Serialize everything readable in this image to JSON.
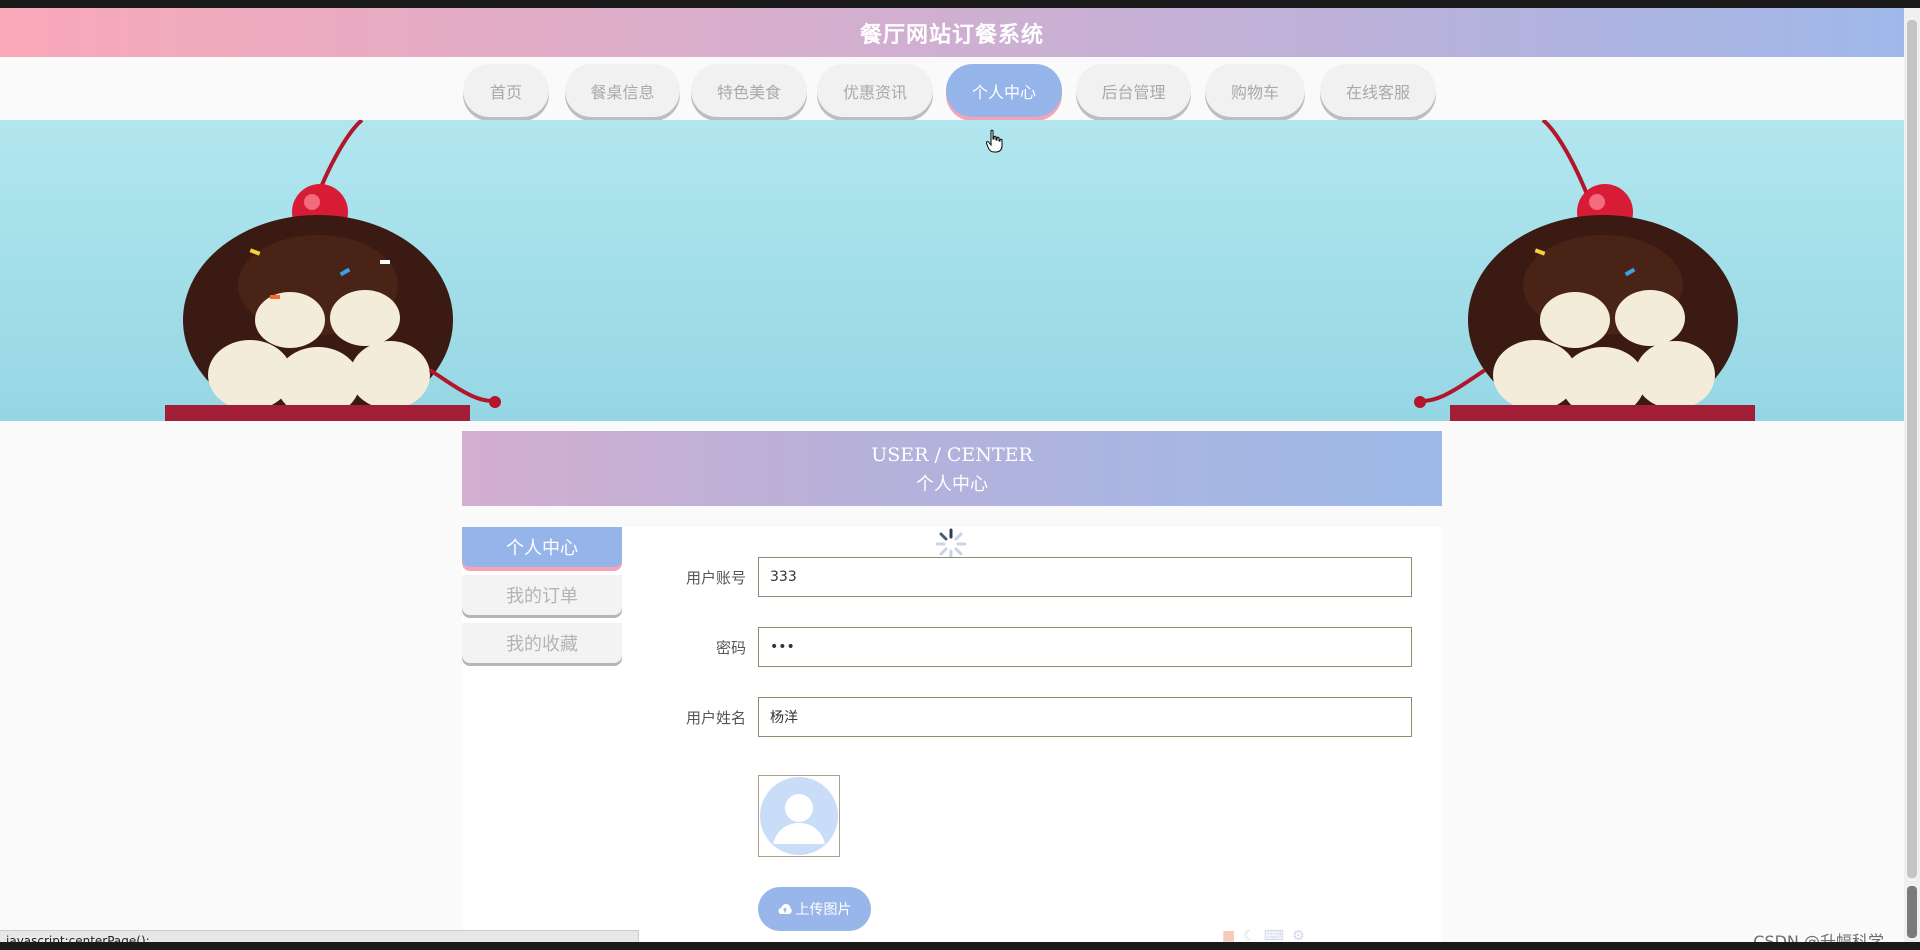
{
  "app": {
    "title": "餐厅网站订餐系统"
  },
  "nav": {
    "items": [
      {
        "label": "首页",
        "active": false
      },
      {
        "label": "餐桌信息",
        "active": false
      },
      {
        "label": "特色美食",
        "active": false
      },
      {
        "label": "优惠资讯",
        "active": false
      },
      {
        "label": "个人中心",
        "active": true
      },
      {
        "label": "后台管理",
        "active": false
      },
      {
        "label": "购物车",
        "active": false
      },
      {
        "label": "在线客服",
        "active": false
      }
    ]
  },
  "panel": {
    "title_en": "USER / CENTER",
    "title_cn": "个人中心"
  },
  "side_menu": {
    "items": [
      {
        "label": "个人中心",
        "active": true
      },
      {
        "label": "我的订单",
        "active": false
      },
      {
        "label": "我的收藏",
        "active": false
      }
    ]
  },
  "form": {
    "account": {
      "label": "用户账号",
      "value": "333"
    },
    "password": {
      "label": "密码",
      "value": "333"
    },
    "name": {
      "label": "用户姓名",
      "value": "杨洋"
    },
    "upload": {
      "label": "上传图片",
      "icon": "cloud-upload-icon"
    }
  },
  "status_bar": {
    "text": "javascript:centerPage();"
  },
  "watermark": {
    "text": "CSDN @升幅科学"
  },
  "colors": {
    "accent": "#94b4ea",
    "accent_pink": "#f7a3b7",
    "banner": "#a3dfe9"
  }
}
